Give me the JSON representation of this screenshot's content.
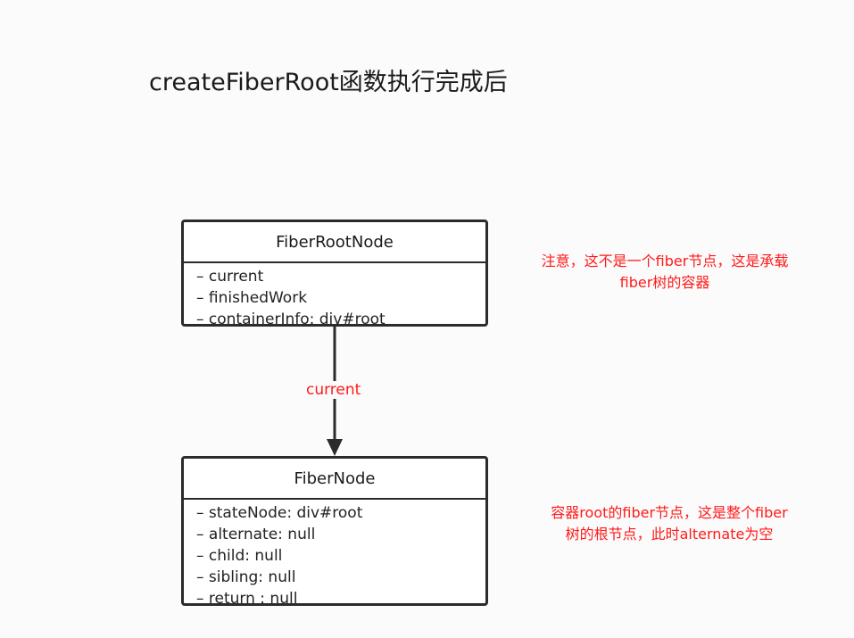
{
  "title": "createFiberRoot函数执行完成后",
  "fiber_root_node": {
    "name": "FiberRootNode",
    "fields": [
      "– current",
      "– finishedWork",
      "– containerInfo: div#root"
    ]
  },
  "fiber_node": {
    "name": "FiberNode",
    "fields": [
      "– stateNode: div#root",
      "– alternate: null",
      "– child: null",
      "– sibling: null",
      "– return : null"
    ]
  },
  "edge": {
    "label": "current"
  },
  "notes": {
    "root_note": [
      "注意，这不是一个fiber节点，这是承载",
      "fiber树的容器"
    ],
    "fiber_note": [
      "容器root的fiber节点，这是整个fiber",
      "树的根节点，此时alternate为空"
    ]
  },
  "colors": {
    "annotation": "#ff1a1a",
    "stroke": "#2b2b2b"
  }
}
